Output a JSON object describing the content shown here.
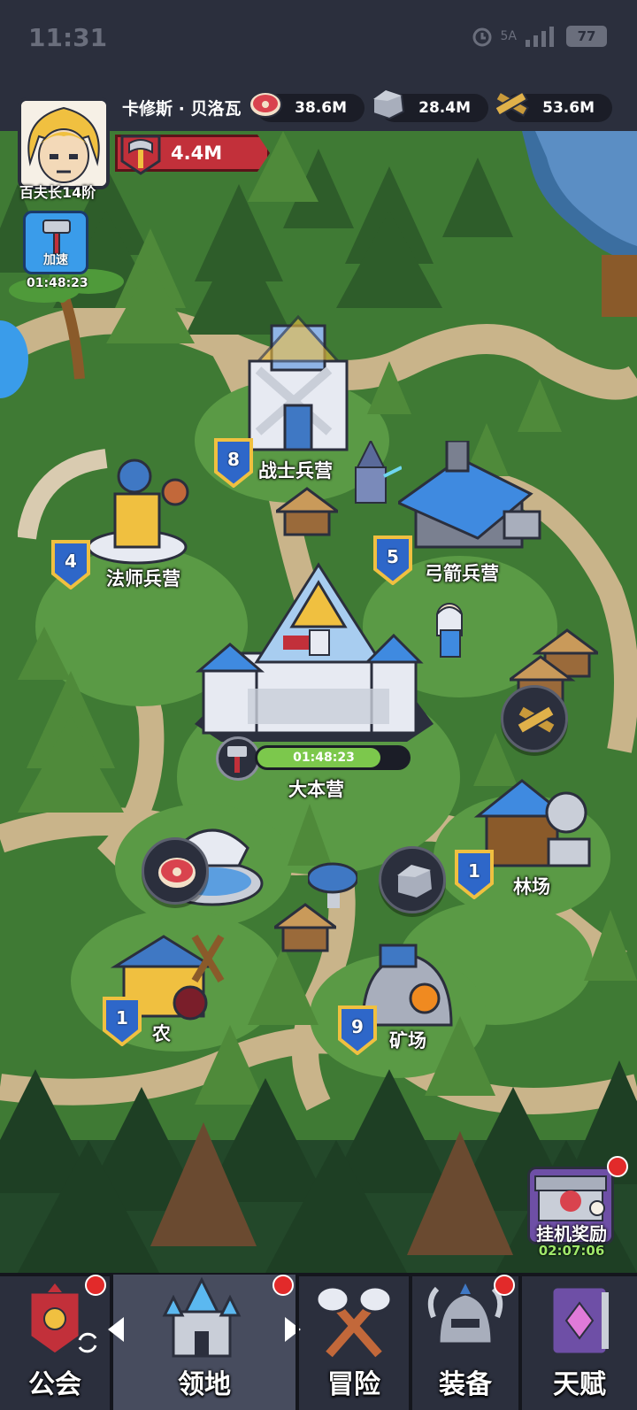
{
  "status_bar": {
    "time": "11:31",
    "network": "5A",
    "battery": "77"
  },
  "player": {
    "name": "卡修斯 · 贝洛瓦",
    "rank": "百夫长14阶",
    "power": "4.4M"
  },
  "resources": [
    {
      "name": "meat-icon",
      "value": "38.6M"
    },
    {
      "name": "stone-icon",
      "value": "28.4M"
    },
    {
      "name": "wood-icon",
      "value": "53.6M"
    }
  ],
  "boost": {
    "label": "加速",
    "timer": "01:48:23"
  },
  "buildings": {
    "warrior": {
      "label": "战士兵营",
      "level": "8"
    },
    "mage": {
      "label": "法师兵营",
      "level": "4"
    },
    "archer": {
      "label": "弓箭兵营",
      "level": "5"
    },
    "hq": {
      "label": "大本营",
      "timer": "01:48:23",
      "progress": 0.82
    },
    "lumber": {
      "label": "林场",
      "level": "1"
    },
    "farm": {
      "label": "农",
      "level": "1"
    },
    "mine": {
      "label": "矿场",
      "level": "9"
    }
  },
  "idle_reward": {
    "label": "挂机奖励",
    "timer": "02:07:06"
  },
  "nav": {
    "guild": "公会",
    "territory": "领地",
    "adventure": "冒险",
    "equipment": "装备",
    "talent": "天赋"
  },
  "colors": {
    "accent_red": "#c2303a",
    "progress_green": "#7cc84c",
    "panel_dark": "#2b2f3d",
    "badge_blue": "#2e67c9"
  }
}
